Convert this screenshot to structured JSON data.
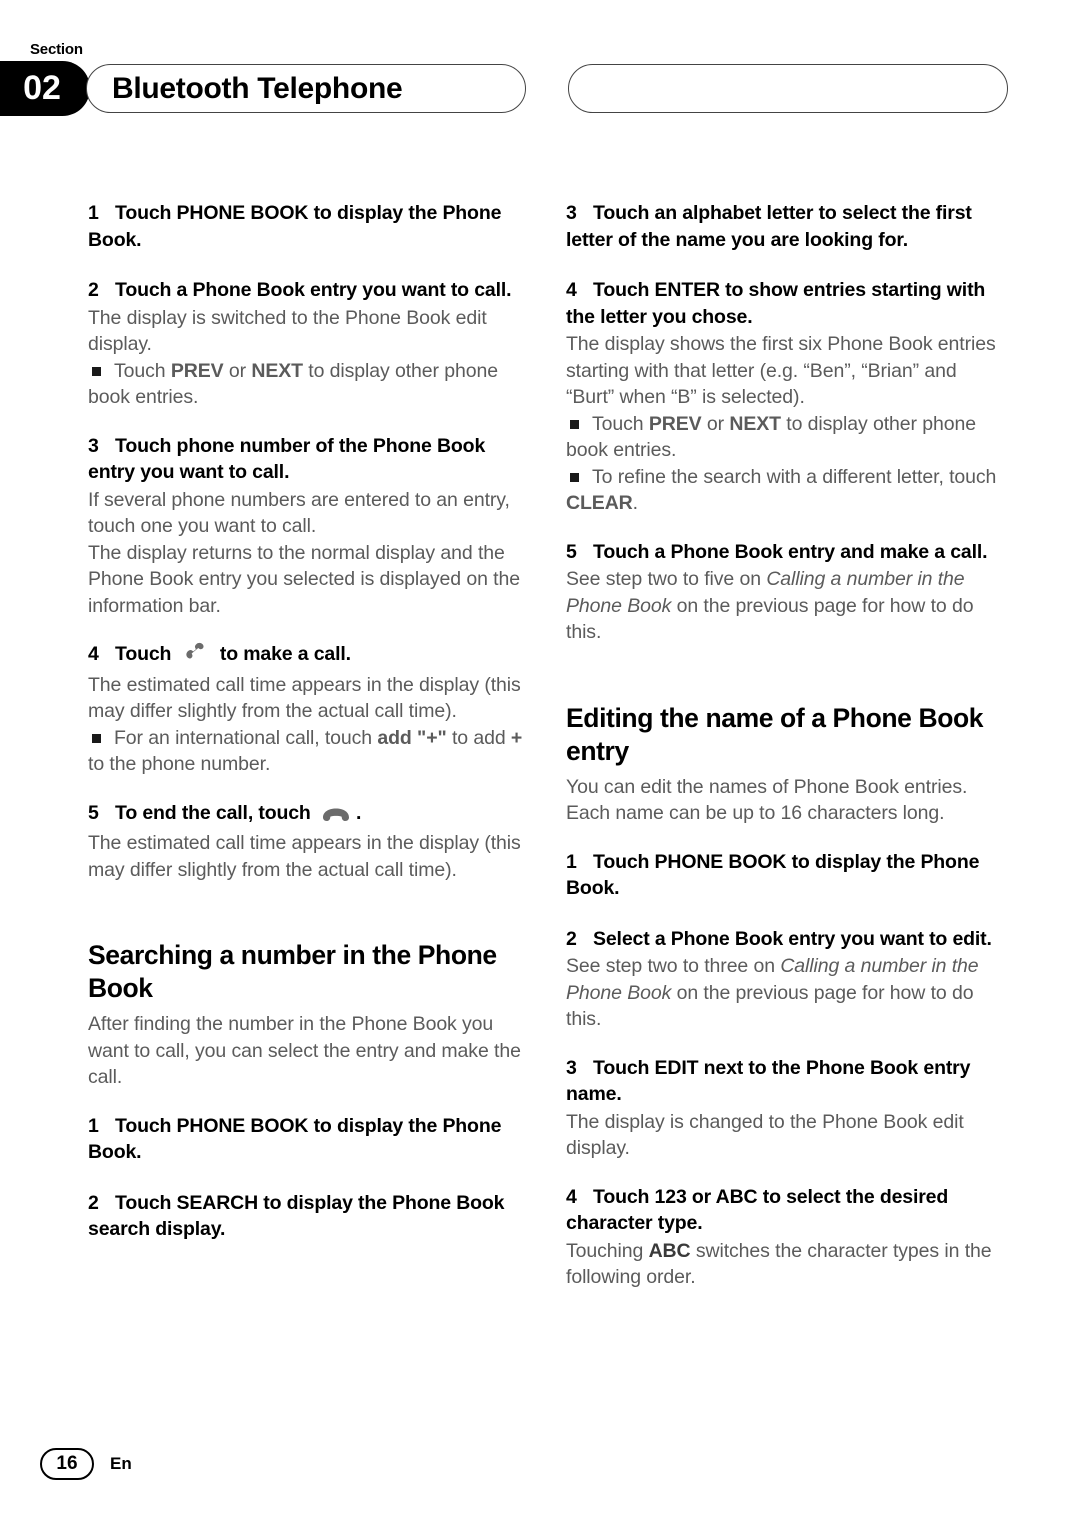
{
  "header": {
    "section_label": "Section",
    "section_number": "02",
    "title": "Bluetooth Telephone",
    "right_pill_text": ""
  },
  "left_column": {
    "step1": {
      "num": "1",
      "text": "Touch PHONE BOOK to display the Phone Book."
    },
    "step2": {
      "num": "2",
      "text": "Touch a Phone Book entry you want to call."
    },
    "step2_body": "The display is switched to the Phone Book edit display.",
    "step2_bullet_pre": "Touch ",
    "step2_bullet_b1": "PREV",
    "step2_bullet_mid": " or ",
    "step2_bullet_b2": "NEXT",
    "step2_bullet_post": " to display other phone book entries.",
    "step3": {
      "num": "3",
      "text": "Touch phone number of the Phone Book entry you want to call."
    },
    "step3_body1": "If several phone numbers are entered to an entry, touch one you want to call.",
    "step3_body2": "The display returns to the normal display and the Phone Book entry you selected is displayed on the information bar.",
    "step4_num": "4",
    "step4_pre": "Touch",
    "step4_post": "to make a call.",
    "step4_icon": "off-hook-handset-icon",
    "step4_body": "The estimated call time appears in the display (this may differ slightly from the actual call time).",
    "step4_bullet_pre": "For an international call, touch ",
    "step4_bullet_b1": "add \"+\"",
    "step4_bullet_post": " to add ",
    "step4_bullet_plus": "+",
    "step4_bullet_tail": " to the phone number.",
    "step5_num": "5",
    "step5_pre": "To end the call, touch",
    "step5_post": ".",
    "step5_icon": "on-hook-handset-icon",
    "step5_body": "The estimated call time appears in the display (this may differ slightly from the actual call time).",
    "heading_search": "Searching a number in the Phone Book",
    "search_intro": "After finding the number in the Phone Book you want to call, you can select the entry and make the call.",
    "search_step1": {
      "num": "1",
      "text": "Touch PHONE BOOK to display the Phone Book."
    },
    "search_step2": {
      "num": "2",
      "text": "Touch SEARCH to display the Phone Book search display."
    }
  },
  "right_column": {
    "step3": {
      "num": "3",
      "text": "Touch an alphabet letter to select the first letter of the name you are looking for."
    },
    "step4": {
      "num": "4",
      "text": "Touch ENTER to show entries starting with the letter you chose."
    },
    "step4_body": "The display shows the first six Phone Book entries starting with that letter (e.g. “Ben”, “Brian” and “Burt” when “B” is selected).",
    "bullet1_pre": "Touch ",
    "bullet1_b1": "PREV",
    "bullet1_mid": " or ",
    "bullet1_b2": "NEXT",
    "bullet1_post": " to display other phone book entries.",
    "bullet2_pre": "To refine the search with a different letter, touch ",
    "bullet2_b1": "CLEAR",
    "bullet2_post": ".",
    "step5": {
      "num": "5",
      "text": "Touch a Phone Book entry and make a call."
    },
    "step5_body_pre": "See step two to five on ",
    "step5_body_italic": "Calling a number in the Phone Book",
    "step5_body_post": " on the previous page for how to do this.",
    "heading_editing": "Editing the name of a Phone Book entry",
    "editing_intro": "You can edit the names of Phone Book entries. Each name can be up to 16 characters long.",
    "edit_step1": {
      "num": "1",
      "text": "Touch PHONE BOOK to display the Phone Book."
    },
    "edit_step2": {
      "num": "2",
      "text": "Select a Phone Book entry you want to edit."
    },
    "edit_step2_body_pre": "See step two to three on ",
    "edit_step2_body_italic": "Calling a number in the Phone Book",
    "edit_step2_body_post": " on the previous page for how to do this.",
    "edit_step3": {
      "num": "3",
      "text": "Touch EDIT next to the Phone Book entry name."
    },
    "edit_step3_body": "The display is changed to the Phone Book edit display.",
    "edit_step4": {
      "num": "4",
      "text": "Touch 123 or ABC to select the desired character type."
    },
    "edit_step4_body_pre": "Touching ",
    "edit_step4_body_b": "ABC",
    "edit_step4_body_post": " switches the character types in the following order."
  },
  "footer": {
    "page_number": "16",
    "language": "En"
  },
  "colors": {
    "heading": "#000000",
    "body": "#5b5b5b",
    "badge_bg": "#000000"
  }
}
